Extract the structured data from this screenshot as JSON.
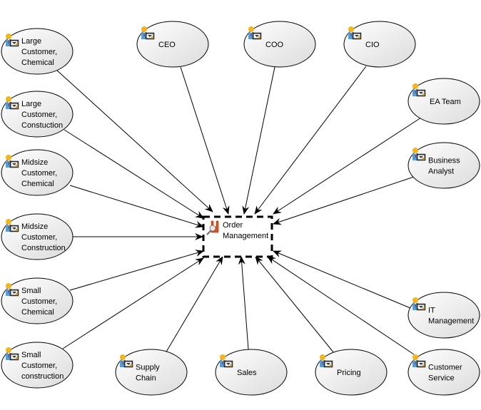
{
  "diagram": {
    "type": "stakeholder-map",
    "center": {
      "id": "order-management",
      "label_lines": [
        "Order",
        "Management"
      ],
      "icon": "process-search-icon",
      "border": "dashed"
    },
    "stakeholders": [
      {
        "id": "large-customer-chemical",
        "label_lines": [
          "Large",
          "Customer,",
          "Chemical"
        ],
        "icon": "stakeholder-icon"
      },
      {
        "id": "large-customer-construction",
        "label_lines": [
          "Large",
          "Customer,",
          "Constuction"
        ],
        "icon": "stakeholder-icon"
      },
      {
        "id": "midsize-customer-chemical",
        "label_lines": [
          "Midsize",
          "Customer,",
          "Chemical"
        ],
        "icon": "stakeholder-icon"
      },
      {
        "id": "midsize-customer-construction",
        "label_lines": [
          "Midsize",
          "Customer,",
          "Construction"
        ],
        "icon": "stakeholder-icon"
      },
      {
        "id": "small-customer-chemical",
        "label_lines": [
          "Small",
          "Customer,",
          "Chemical"
        ],
        "icon": "stakeholder-icon"
      },
      {
        "id": "small-customer-construction",
        "label_lines": [
          "Small",
          "Customer,",
          "construction"
        ],
        "icon": "stakeholder-icon"
      },
      {
        "id": "ceo",
        "label_lines": [
          "CEO"
        ],
        "icon": "stakeholder-icon"
      },
      {
        "id": "coo",
        "label_lines": [
          "COO"
        ],
        "icon": "stakeholder-icon"
      },
      {
        "id": "cio",
        "label_lines": [
          "CIO"
        ],
        "icon": "stakeholder-icon"
      },
      {
        "id": "ea-team",
        "label_lines": [
          "EA Team"
        ],
        "icon": "stakeholder-icon"
      },
      {
        "id": "business-analyst",
        "label_lines": [
          "Business",
          "Analyst"
        ],
        "icon": "stakeholder-icon"
      },
      {
        "id": "it-management",
        "label_lines": [
          "IT",
          "Management"
        ],
        "icon": "stakeholder-icon"
      },
      {
        "id": "customer-service",
        "label_lines": [
          "Customer",
          "Service"
        ],
        "icon": "stakeholder-icon"
      },
      {
        "id": "pricing",
        "label_lines": [
          "Pricing"
        ],
        "icon": "stakeholder-icon"
      },
      {
        "id": "sales",
        "label_lines": [
          "Sales"
        ],
        "icon": "stakeholder-icon"
      },
      {
        "id": "supply-chain",
        "label_lines": [
          "Supply",
          "Chain"
        ],
        "icon": "stakeholder-icon"
      }
    ],
    "edges_direction": "stakeholder-to-center",
    "colors": {
      "ellipse_fill_light": "#ffffff",
      "ellipse_fill_dark": "#e0e0e0",
      "stroke": "#000000",
      "process_icon": "#e0501a"
    }
  }
}
